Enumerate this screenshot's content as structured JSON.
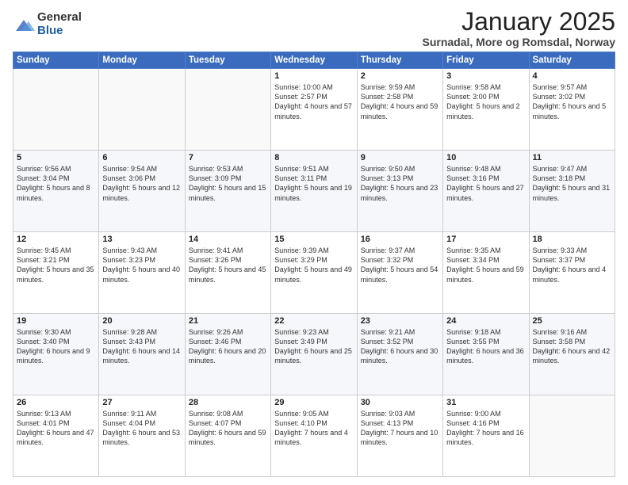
{
  "logo": {
    "general": "General",
    "blue": "Blue"
  },
  "header": {
    "title": "January 2025",
    "subtitle": "Surnadal, More og Romsdal, Norway"
  },
  "weekdays": [
    "Sunday",
    "Monday",
    "Tuesday",
    "Wednesday",
    "Thursday",
    "Friday",
    "Saturday"
  ],
  "weeks": [
    [
      {
        "day": "",
        "info": ""
      },
      {
        "day": "",
        "info": ""
      },
      {
        "day": "",
        "info": ""
      },
      {
        "day": "1",
        "info": "Sunrise: 10:00 AM\nSunset: 2:57 PM\nDaylight: 4 hours\nand 57 minutes."
      },
      {
        "day": "2",
        "info": "Sunrise: 9:59 AM\nSunset: 2:58 PM\nDaylight: 4 hours\nand 59 minutes."
      },
      {
        "day": "3",
        "info": "Sunrise: 9:58 AM\nSunset: 3:00 PM\nDaylight: 5 hours\nand 2 minutes."
      },
      {
        "day": "4",
        "info": "Sunrise: 9:57 AM\nSunset: 3:02 PM\nDaylight: 5 hours\nand 5 minutes."
      }
    ],
    [
      {
        "day": "5",
        "info": "Sunrise: 9:56 AM\nSunset: 3:04 PM\nDaylight: 5 hours\nand 8 minutes."
      },
      {
        "day": "6",
        "info": "Sunrise: 9:54 AM\nSunset: 3:06 PM\nDaylight: 5 hours\nand 12 minutes."
      },
      {
        "day": "7",
        "info": "Sunrise: 9:53 AM\nSunset: 3:09 PM\nDaylight: 5 hours\nand 15 minutes."
      },
      {
        "day": "8",
        "info": "Sunrise: 9:51 AM\nSunset: 3:11 PM\nDaylight: 5 hours\nand 19 minutes."
      },
      {
        "day": "9",
        "info": "Sunrise: 9:50 AM\nSunset: 3:13 PM\nDaylight: 5 hours\nand 23 minutes."
      },
      {
        "day": "10",
        "info": "Sunrise: 9:48 AM\nSunset: 3:16 PM\nDaylight: 5 hours\nand 27 minutes."
      },
      {
        "day": "11",
        "info": "Sunrise: 9:47 AM\nSunset: 3:18 PM\nDaylight: 5 hours\nand 31 minutes."
      }
    ],
    [
      {
        "day": "12",
        "info": "Sunrise: 9:45 AM\nSunset: 3:21 PM\nDaylight: 5 hours\nand 35 minutes."
      },
      {
        "day": "13",
        "info": "Sunrise: 9:43 AM\nSunset: 3:23 PM\nDaylight: 5 hours\nand 40 minutes."
      },
      {
        "day": "14",
        "info": "Sunrise: 9:41 AM\nSunset: 3:26 PM\nDaylight: 5 hours\nand 45 minutes."
      },
      {
        "day": "15",
        "info": "Sunrise: 9:39 AM\nSunset: 3:29 PM\nDaylight: 5 hours\nand 49 minutes."
      },
      {
        "day": "16",
        "info": "Sunrise: 9:37 AM\nSunset: 3:32 PM\nDaylight: 5 hours\nand 54 minutes."
      },
      {
        "day": "17",
        "info": "Sunrise: 9:35 AM\nSunset: 3:34 PM\nDaylight: 5 hours\nand 59 minutes."
      },
      {
        "day": "18",
        "info": "Sunrise: 9:33 AM\nSunset: 3:37 PM\nDaylight: 6 hours\nand 4 minutes."
      }
    ],
    [
      {
        "day": "19",
        "info": "Sunrise: 9:30 AM\nSunset: 3:40 PM\nDaylight: 6 hours\nand 9 minutes."
      },
      {
        "day": "20",
        "info": "Sunrise: 9:28 AM\nSunset: 3:43 PM\nDaylight: 6 hours\nand 14 minutes."
      },
      {
        "day": "21",
        "info": "Sunrise: 9:26 AM\nSunset: 3:46 PM\nDaylight: 6 hours\nand 20 minutes."
      },
      {
        "day": "22",
        "info": "Sunrise: 9:23 AM\nSunset: 3:49 PM\nDaylight: 6 hours\nand 25 minutes."
      },
      {
        "day": "23",
        "info": "Sunrise: 9:21 AM\nSunset: 3:52 PM\nDaylight: 6 hours\nand 30 minutes."
      },
      {
        "day": "24",
        "info": "Sunrise: 9:18 AM\nSunset: 3:55 PM\nDaylight: 6 hours\nand 36 minutes."
      },
      {
        "day": "25",
        "info": "Sunrise: 9:16 AM\nSunset: 3:58 PM\nDaylight: 6 hours\nand 42 minutes."
      }
    ],
    [
      {
        "day": "26",
        "info": "Sunrise: 9:13 AM\nSunset: 4:01 PM\nDaylight: 6 hours\nand 47 minutes."
      },
      {
        "day": "27",
        "info": "Sunrise: 9:11 AM\nSunset: 4:04 PM\nDaylight: 6 hours\nand 53 minutes."
      },
      {
        "day": "28",
        "info": "Sunrise: 9:08 AM\nSunset: 4:07 PM\nDaylight: 6 hours\nand 59 minutes."
      },
      {
        "day": "29",
        "info": "Sunrise: 9:05 AM\nSunset: 4:10 PM\nDaylight: 7 hours\nand 4 minutes."
      },
      {
        "day": "30",
        "info": "Sunrise: 9:03 AM\nSunset: 4:13 PM\nDaylight: 7 hours\nand 10 minutes."
      },
      {
        "day": "31",
        "info": "Sunrise: 9:00 AM\nSunset: 4:16 PM\nDaylight: 7 hours\nand 16 minutes."
      },
      {
        "day": "",
        "info": ""
      }
    ]
  ]
}
